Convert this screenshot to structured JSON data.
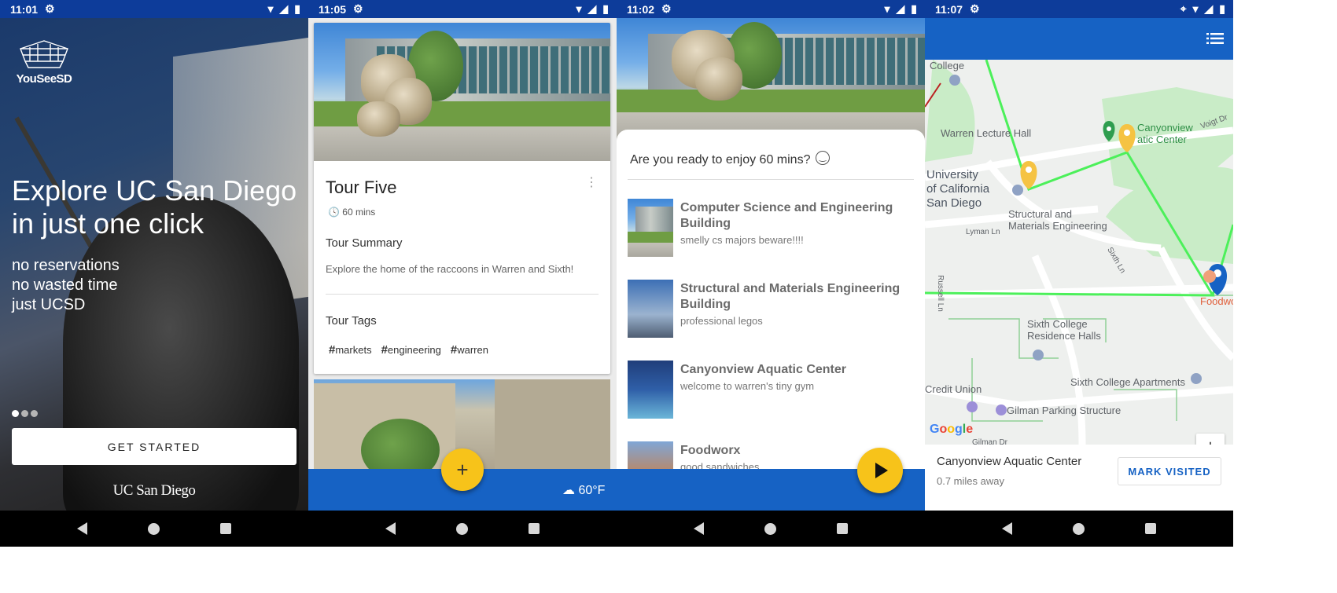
{
  "status_bars": [
    {
      "time": "11:01"
    },
    {
      "time": "11:05"
    },
    {
      "time": "11:02"
    },
    {
      "time": "11:07"
    }
  ],
  "welcome": {
    "logo_text": "YouSeeSD",
    "headline": "Explore UC San Diego in just one click",
    "taglines": [
      "no reservations",
      "no wasted time",
      "just UCSD"
    ],
    "get_started": "GET STARTED",
    "university_wordmark": "UC San Diego"
  },
  "tour_detail": {
    "title": "Tour Five",
    "duration": "60 mins",
    "summary_heading": "Tour Summary",
    "summary": "Explore the home of the raccoons in Warren and Sixth!",
    "tags_heading": "Tour Tags",
    "tags": [
      "markets",
      "engineering",
      "warren"
    ],
    "weather": "60°F",
    "fab_label": "+"
  },
  "tour_stops": {
    "prompt": "Are you ready to enjoy 60 mins?",
    "stops": [
      {
        "name": "Computer Science and Engineering Building",
        "desc": "smelly cs majors beware!!!!"
      },
      {
        "name": "Structural and Materials Engineering Building",
        "desc": "professional legos"
      },
      {
        "name": "Canyonview Aquatic Center",
        "desc": "welcome to warren's tiny gym"
      },
      {
        "name": "Foodworx",
        "desc": "good sandwiches"
      }
    ]
  },
  "map_view": {
    "labels": {
      "college": "College",
      "warren_lecture": "Warren Lecture Hall",
      "canyonview": "Canyonview\natic Center",
      "ucsd": "University\nof California\nSan Diego",
      "sme": "Structural and\nMaterials Engineering",
      "lyman": "Lyman Ln",
      "sixth_ln": "Sixth Ln",
      "voigt": "Voigt Dr",
      "russell": "Russell Ln",
      "sixth_res": "Sixth College\nResidence Halls",
      "credit_union": "Credit Union",
      "sixth_apts": "Sixth College Apartments",
      "gilman_parking": "Gilman Parking Structure",
      "foodworx": "Foodwo",
      "gilman_dr": "Gilman Dr",
      "google": "Google"
    },
    "zoom_in": "+",
    "zoom_out": "−",
    "place_name": "Canyonview Aquatic Center",
    "place_distance": "0.7 miles away",
    "mark_visited": "MARK VISITED"
  },
  "colors": {
    "status_bar": "#0d3c9a",
    "app_bar": "#1662c4",
    "accent": "#f7c31a",
    "route": "#4cf05a"
  }
}
